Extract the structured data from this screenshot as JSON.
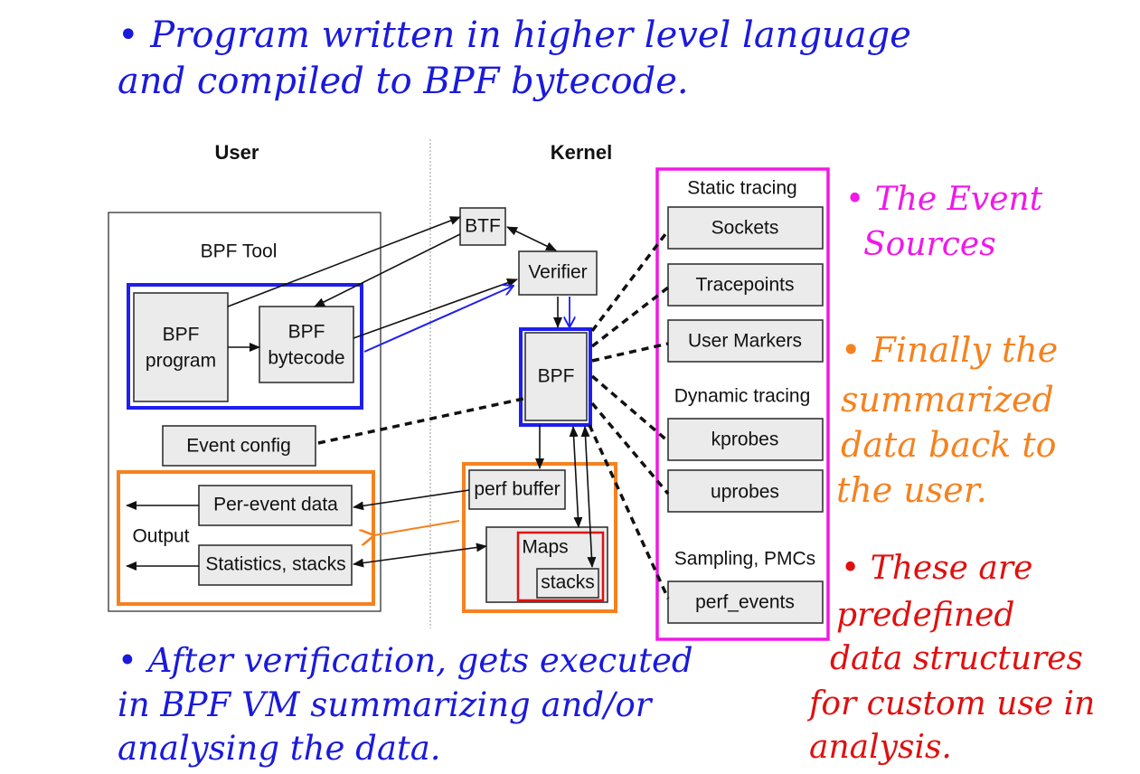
{
  "colors": {
    "note_blue": "#1a1adb",
    "highlight_blue": "#1e1ef0",
    "event_sources_magenta": "#f018e8",
    "output_orange": "#f5821f",
    "maps_red": "#e01010",
    "box_fill": "#ebebeb"
  },
  "annotations": {
    "top_note": [
      "• Program written in higher level language",
      "and compiled to BPF bytecode."
    ],
    "bottom_note": [
      "• After verification, gets executed",
      "in BPF VM summarizing and/or",
      "analysing the data."
    ],
    "event_sources_note": [
      "• The Event",
      "Sources"
    ],
    "output_note": [
      "• Finally the",
      "summarized",
      "data back to",
      "the user."
    ],
    "maps_note": [
      "• These are",
      "predefined",
      "data structures",
      "for custom use in",
      "analysis."
    ]
  },
  "diagram": {
    "user_header": "User",
    "kernel_header": "Kernel",
    "bpf_tool": {
      "title": "BPF Tool",
      "bpf_program": [
        "BPF",
        "program"
      ],
      "bpf_bytecode": [
        "BPF",
        "bytecode"
      ],
      "event_config": "Event config",
      "output_label": "Output",
      "per_event_data": "Per-event data",
      "statistics_stacks": "Statistics, stacks"
    },
    "kernel": {
      "btf": "BTF",
      "verifier": "Verifier",
      "bpf": "BPF",
      "perf_buffer": "perf buffer",
      "maps": "Maps",
      "stacks": "stacks"
    },
    "event_sources": {
      "static_tracing": "Static tracing",
      "sockets": "Sockets",
      "tracepoints": "Tracepoints",
      "user_markers": "User Markers",
      "dynamic_tracing": "Dynamic tracing",
      "kprobes": "kprobes",
      "uprobes": "uprobes",
      "sampling_pmcs": "Sampling, PMCs",
      "perf_events": "perf_events"
    }
  }
}
